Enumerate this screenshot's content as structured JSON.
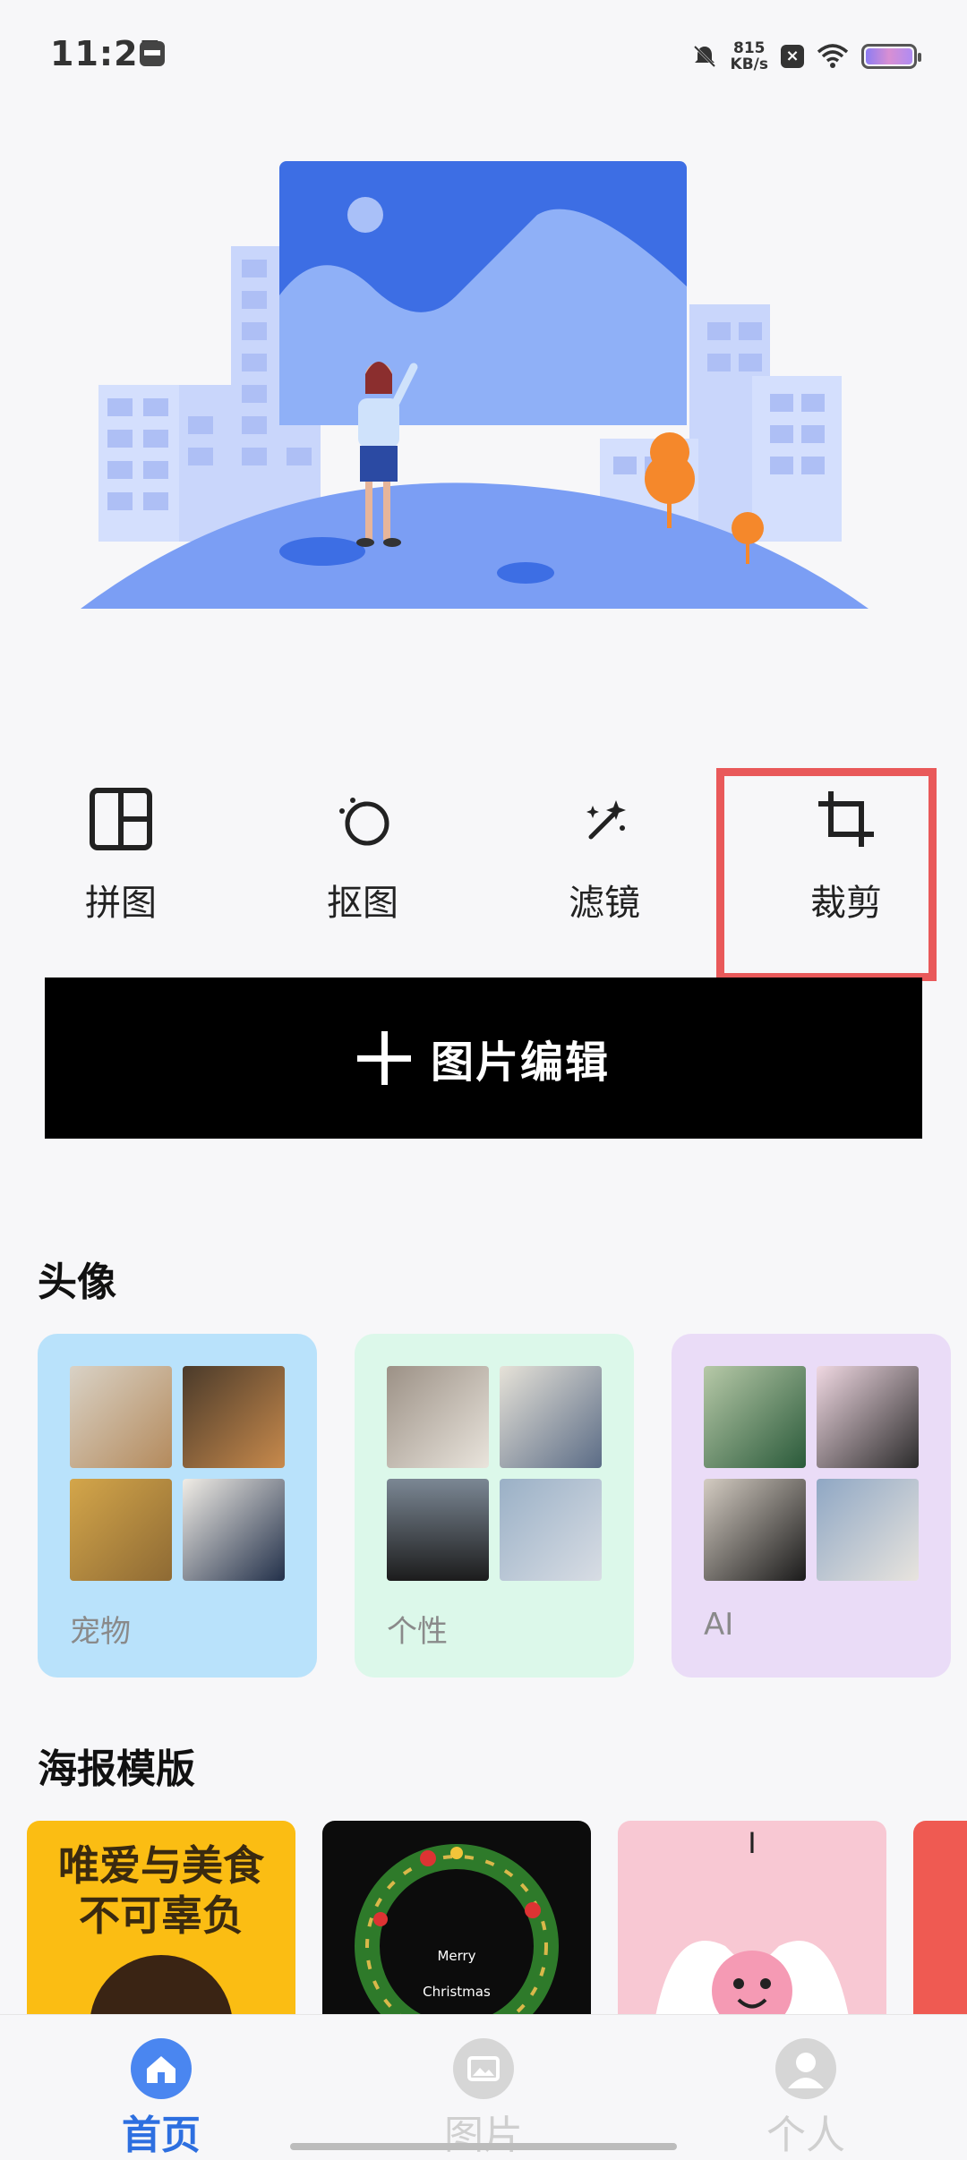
{
  "status_bar": {
    "time": "11:25",
    "net_speed_value": "815",
    "net_speed_unit": "KB/s"
  },
  "tools": [
    {
      "label": "拼图",
      "icon": "collage-icon"
    },
    {
      "label": "抠图",
      "icon": "cutout-icon"
    },
    {
      "label": "滤镜",
      "icon": "magic-wand-icon"
    },
    {
      "label": "裁剪",
      "icon": "crop-icon"
    }
  ],
  "edit_button": {
    "label": "图片编辑"
  },
  "avatar_section": {
    "title": "头像",
    "cards": [
      {
        "label": "宠物",
        "bg": "#b9e2fb"
      },
      {
        "label": "个性",
        "bg": "#dcf8ea"
      },
      {
        "label": "AI",
        "bg": "#eadcf7"
      }
    ]
  },
  "poster_section": {
    "title": "海报模版",
    "posters": [
      {
        "text": "唯爱与美食\n不可辜负"
      },
      {
        "text_line1": "Merry",
        "text_line2": "Christmas"
      },
      {
        "text": "I"
      }
    ]
  },
  "bottom_nav": [
    {
      "label": "首页",
      "active": true,
      "color": "#2d6fe0"
    },
    {
      "label": "图片",
      "active": false,
      "color": "#cfcfcf"
    },
    {
      "label": "个人",
      "active": false,
      "color": "#cfcfcf"
    }
  ],
  "colors": {
    "accent": "#2d6fe0",
    "highlight": "#e9595a"
  }
}
